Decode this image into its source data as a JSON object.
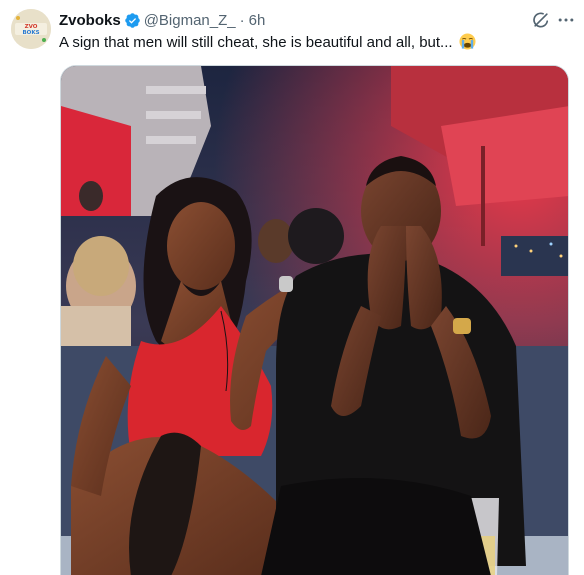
{
  "tweet": {
    "author_name": "Zvoboks",
    "handle": "@Bigman_Z_",
    "separator": "·",
    "timestamp": "6h",
    "text": "A sign that men will still cheat, she is beautiful and all, but...",
    "emoji": "loudly-crying-face"
  },
  "icons": {
    "verified": "verified-badge-icon",
    "grok": "grok-icon",
    "more": "more-options-icon"
  },
  "colors": {
    "verified_blue": "#1d9bf0",
    "text_primary": "#0f1419",
    "text_secondary": "#536471"
  },
  "avatar": {
    "text": "Zvoboks"
  }
}
